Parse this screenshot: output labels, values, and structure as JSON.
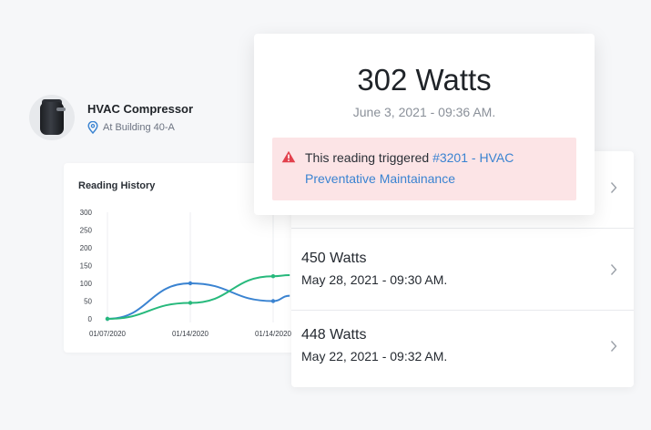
{
  "asset": {
    "name": "HVAC Compressor",
    "location": "At Building 40-A",
    "icons": {
      "avatar": "compressor-image",
      "location": "map-pin-icon"
    },
    "location_color": "#3a83d1"
  },
  "chart": {
    "title": "Reading History"
  },
  "chart_data": {
    "type": "line",
    "title": "Reading History",
    "x": [
      "01/07/2020",
      "01/14/2020",
      "01/14/2020"
    ],
    "y_ticks": [
      0,
      50,
      100,
      150,
      200,
      250,
      300
    ],
    "ylim": [
      0,
      300
    ],
    "grid": "vertical",
    "series": [
      {
        "color": "#3a83d1",
        "x_points": [
          0,
          1,
          2,
          2.2
        ],
        "values": [
          0,
          100,
          50,
          65
        ]
      },
      {
        "color": "#27b97c",
        "x_points": [
          0,
          1,
          2,
          2.2
        ],
        "values": [
          0,
          45,
          120,
          123
        ]
      }
    ]
  },
  "popup": {
    "watts": "302 Watts",
    "date": "June 3, 2021 - 09:36 AM.",
    "alert": {
      "prefix": "This reading triggered ",
      "link": "#3201 - HVAC Preventative Maintainance",
      "icon": "warning-icon",
      "background": "#fce4e6",
      "icon_color": "#e2414d"
    }
  },
  "readings": [
    {
      "watts": "",
      "date": ""
    },
    {
      "watts": "450 Watts",
      "date": "May 28, 2021 - 09:30 AM."
    },
    {
      "watts": "448 Watts",
      "date": "May 22, 2021 - 09:32 AM."
    }
  ]
}
